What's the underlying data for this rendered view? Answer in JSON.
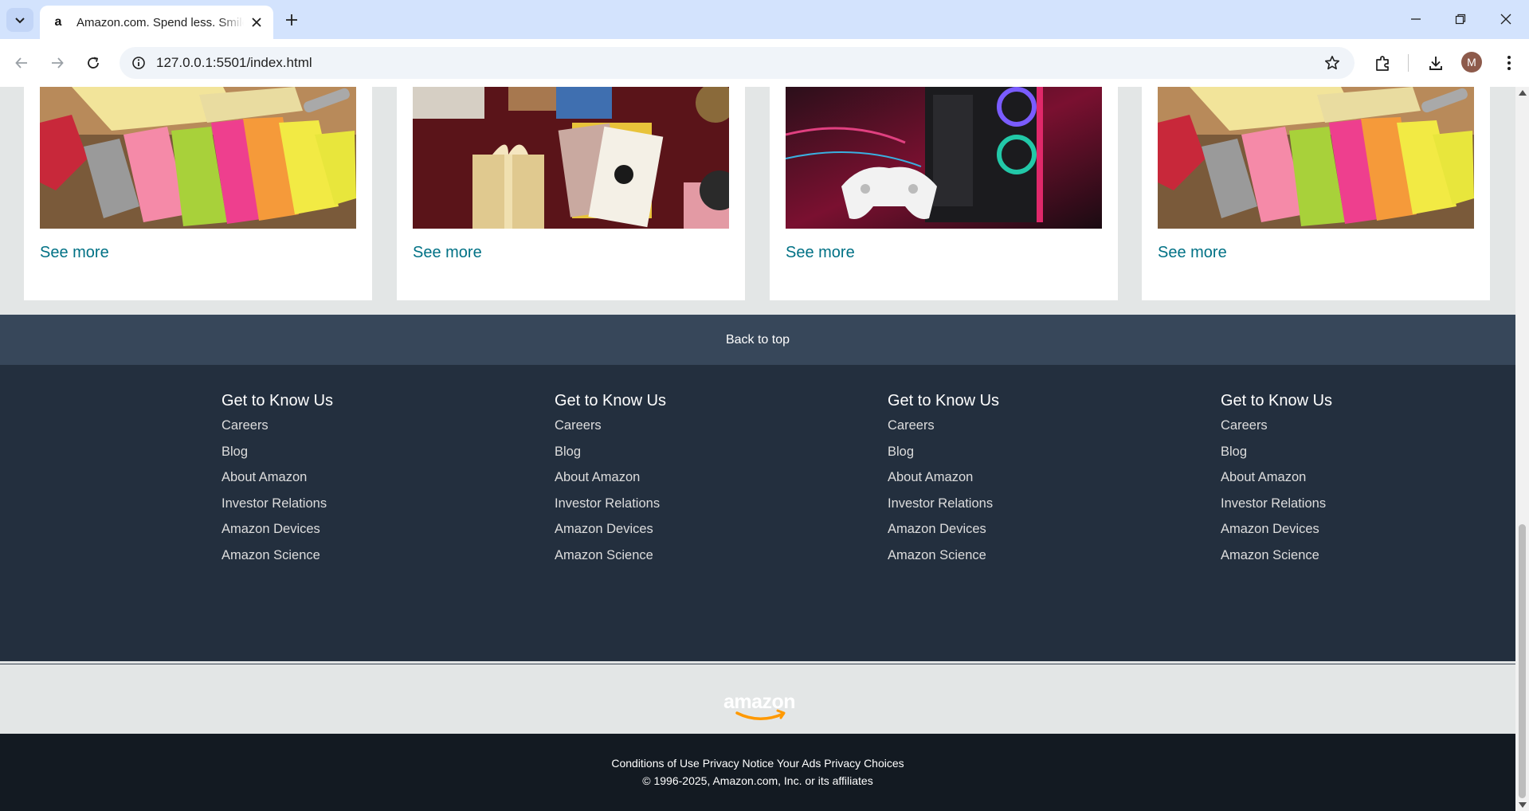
{
  "browser": {
    "tab_title": "Amazon.com. Spend less. Smile more.",
    "favicon_letter": "a",
    "url": "127.0.0.1:5501/index.html",
    "profile_initial": "M",
    "icons": [
      "tab-search-icon",
      "close-icon",
      "plus-icon",
      "minimize-icon",
      "restore-icon",
      "close-window-icon",
      "back-arrow-icon",
      "forward-arrow-icon",
      "reload-icon",
      "site-info-icon",
      "star-icon",
      "extensions-icon",
      "download-icon",
      "kebab-menu-icon"
    ]
  },
  "cards": [
    {
      "image": "office-supplies",
      "see_more": "See more"
    },
    {
      "image": "gift-wrapping",
      "see_more": "See more"
    },
    {
      "image": "gaming-pc-controller",
      "see_more": "See more"
    },
    {
      "image": "office-supplies",
      "see_more": "See more"
    }
  ],
  "back_to_top": "Back to top",
  "footer": {
    "columns": [
      {
        "heading": "Get to Know Us",
        "links": [
          "Careers",
          "Blog",
          "About Amazon",
          "Investor Relations",
          "Amazon Devices",
          "Amazon Science"
        ]
      },
      {
        "heading": "Get to Know Us",
        "links": [
          "Careers",
          "Blog",
          "About Amazon",
          "Investor Relations",
          "Amazon Devices",
          "Amazon Science"
        ]
      },
      {
        "heading": "Get to Know Us",
        "links": [
          "Careers",
          "Blog",
          "About Amazon",
          "Investor Relations",
          "Amazon Devices",
          "Amazon Science"
        ]
      },
      {
        "heading": "Get to Know Us",
        "links": [
          "Careers",
          "Blog",
          "About Amazon",
          "Investor Relations",
          "Amazon Devices",
          "Amazon Science"
        ]
      }
    ],
    "logo_text": "amazon",
    "legal_links": [
      "Conditions of Use",
      "Privacy Notice",
      "Your Ads Privacy Choices"
    ],
    "copyright": "© 1996-2025, Amazon.com, Inc. or its affiliates"
  },
  "colors": {
    "link": "#007185",
    "back_to_top_bg": "#37475a",
    "footer_bg": "#232f3e",
    "bottom_bg": "#131a22",
    "logo_smile": "#ff9900"
  }
}
